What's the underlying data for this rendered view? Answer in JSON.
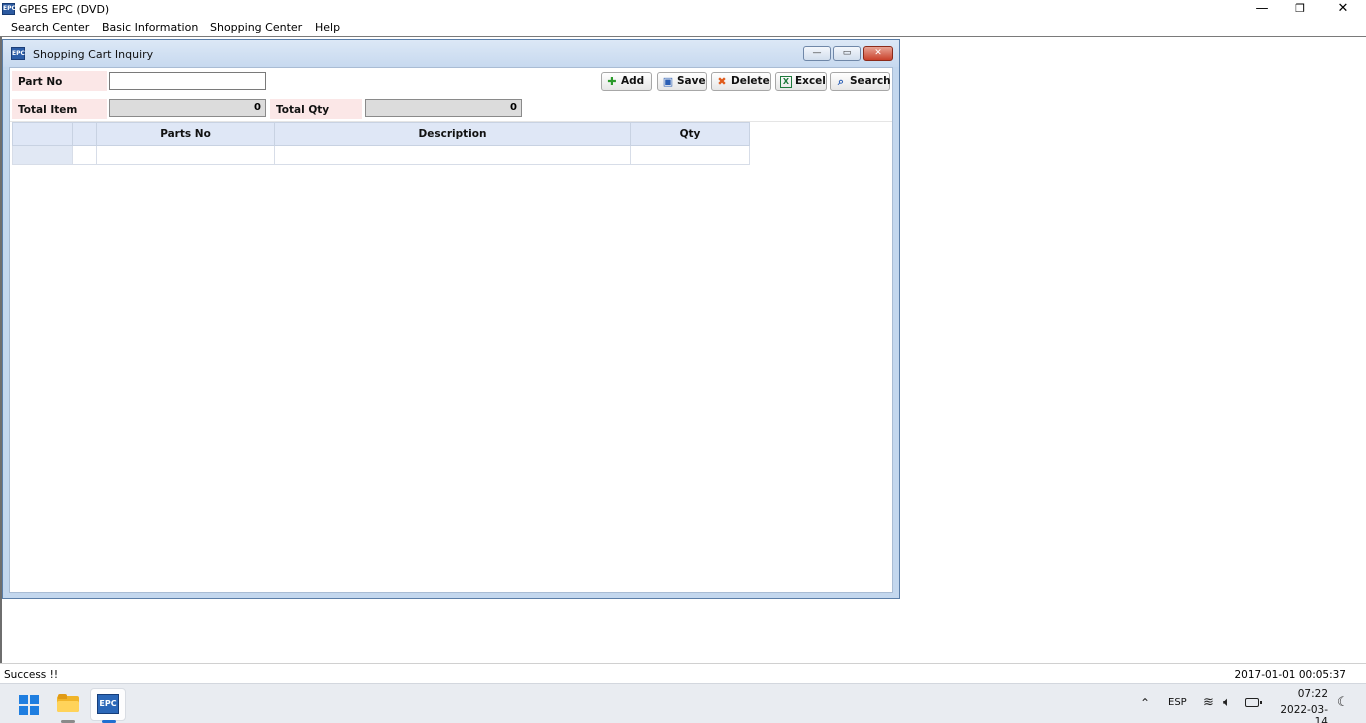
{
  "app": {
    "title": "GPES EPC (DVD)",
    "icon_label": "EPC",
    "window_controls": {
      "minimize": "—",
      "maximize": "❐",
      "close": "✕"
    }
  },
  "menu": {
    "items": [
      {
        "label": "Search Center"
      },
      {
        "label": "Basic Information"
      },
      {
        "label": "Shopping Center"
      },
      {
        "label": "Help"
      }
    ]
  },
  "window": {
    "title": "Shopping Cart Inquiry",
    "icon_label": "EPC",
    "controls": {
      "minimize": "—",
      "maximize": "▭",
      "close": "✕"
    }
  },
  "form": {
    "part_no_label": "Part No",
    "part_no_value": "",
    "total_item_label": "Total Item",
    "total_item_value": "0",
    "total_qty_label": "Total Qty",
    "total_qty_value": "0"
  },
  "toolbar": {
    "add_label": "Add",
    "save_label": "Save",
    "delete_label": "Delete",
    "excel_label": "Excel",
    "search_label": "Search",
    "icons": {
      "add": "add-icon",
      "save": "save-icon",
      "delete": "delete-icon",
      "excel": "excel-icon",
      "search": "search-icon"
    }
  },
  "grid": {
    "columns": [
      "",
      "",
      "Parts No",
      "Description",
      "Qty"
    ],
    "rows": [
      [
        "",
        "",
        "",
        "",
        ""
      ]
    ]
  },
  "status": {
    "message": "Success !!",
    "datetime": "2017-01-01 00:05:37"
  },
  "taskbar": {
    "apps": [
      {
        "name": "Start",
        "icon": "windows-start-icon"
      },
      {
        "name": "File Explorer",
        "icon": "folder-icon"
      },
      {
        "name": "EPC",
        "icon": "epc-app-icon",
        "label": "EPC"
      }
    ],
    "tray": {
      "language": "ESP",
      "time": "07:22",
      "date": "2022-03-14"
    }
  },
  "colors": {
    "label_bg": "#fbe7e7",
    "grid_header_bg": "#dfe7f6",
    "window_frame": "#c3d7ee",
    "close_button": "#c9412b"
  }
}
